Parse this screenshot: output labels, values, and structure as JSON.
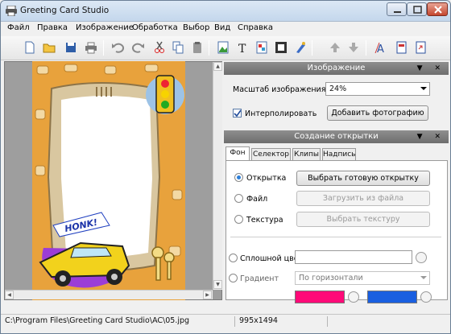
{
  "window": {
    "title": "Greeting Card Studio"
  },
  "menu": [
    "Файл",
    "Правка",
    "Изображение",
    "Обработка",
    "Выбор",
    "Вид",
    "Справка"
  ],
  "toolbar": {
    "icons": [
      "new-document-icon",
      "open-folder-icon",
      "save-icon",
      "print-icon",
      "undo-icon",
      "redo-icon",
      "cut-icon",
      "copy-icon",
      "paste-icon",
      "insert-image-icon",
      "insert-text-icon",
      "insert-shape-icon",
      "frame-icon",
      "brush-icon",
      "bring-forward-icon",
      "send-backward-icon",
      "text-style-icon",
      "page-setup-icon",
      "export-icon"
    ]
  },
  "card": {
    "honk_text": "HONK!"
  },
  "image_panel": {
    "title": "Изображение",
    "scale_label": "Масштаб изображения",
    "scale_value": "24%",
    "interpolate_label": "Интерполировать",
    "interpolate_checked": true,
    "add_photo_button": "Добавить фотографию"
  },
  "card_panel": {
    "title": "Создание открытки",
    "tabs": [
      "Фон",
      "Селектор",
      "Клипы",
      "Надпись"
    ],
    "active_tab": "Фон",
    "options": [
      {
        "label": "Открытка",
        "button": "Выбрать готовую открытку",
        "selected": true,
        "enabled": true
      },
      {
        "label": "Файл",
        "button": "Загрузить из файла",
        "selected": false,
        "enabled": false
      },
      {
        "label": "Текстура",
        "button": "Выбрать текстуру",
        "selected": false,
        "enabled": false
      }
    ],
    "solid_color_label": "Сплошной цвет",
    "gradient_label": "Градиент",
    "gradient_direction": "По горизонтали",
    "gradient_colors": [
      "#ff0a78",
      "#1a5fe0"
    ]
  },
  "status": {
    "path": "C:\\Program Files\\Greeting Card Studio\\AC\\05.jpg",
    "size": "995x1494"
  }
}
